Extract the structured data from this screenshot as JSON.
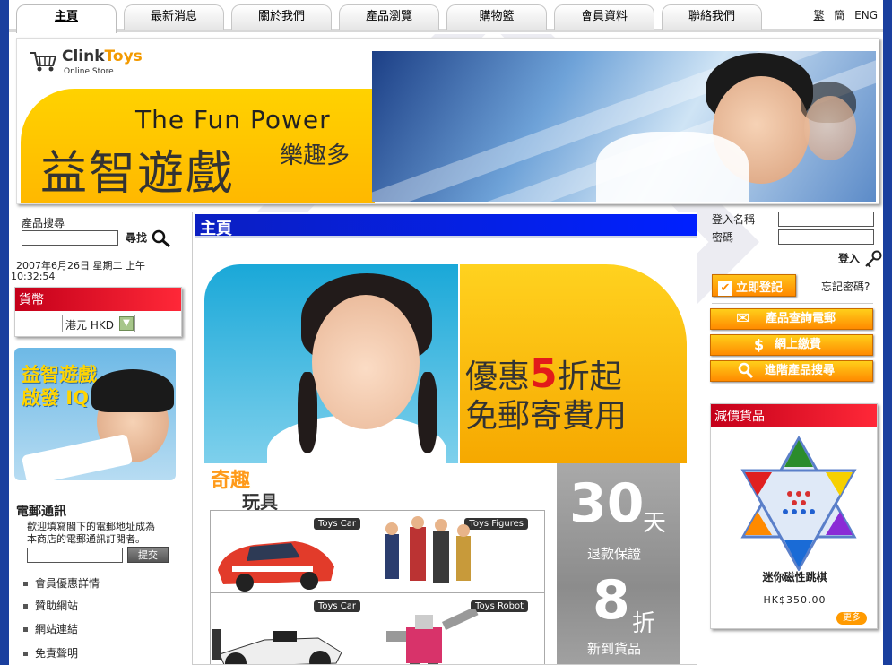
{
  "nav": {
    "tabs": [
      {
        "label": "主頁",
        "active": true
      },
      {
        "label": "最新消息"
      },
      {
        "label": "關於我們"
      },
      {
        "label": "產品瀏覽"
      },
      {
        "label": "購物籃"
      },
      {
        "label": "會員資料"
      },
      {
        "label": "聯絡我們"
      }
    ],
    "languages": [
      "繁",
      "簡",
      "ENG"
    ]
  },
  "banner": {
    "logo_clink": "Clink",
    "logo_toys": "Toys",
    "logo_sub": "Online Store",
    "headline_en": "The Fun Power",
    "headline_big": "益智遊戲",
    "headline_small": "樂趣多"
  },
  "left": {
    "search_label": "產品搜尋",
    "search_button": "尋找",
    "datetime_line1": "2007年6月26日 星期二 上午",
    "datetime_line2": "10:32:54",
    "currency_title": "貨幣",
    "currency_selected": "港元 HKD",
    "promo_line1": "益智遊戲",
    "promo_line2": "啟發 IQ",
    "newsletter_title": "電郵通訊",
    "newsletter_desc1": "歡迎填寫閣下的電郵地址成為",
    "newsletter_desc2": "本商店的電郵通訊訂閱者。",
    "newsletter_submit": "提交",
    "links": [
      "會員優惠詳情",
      "贊助網站",
      "網站連結",
      "免責聲明"
    ]
  },
  "main": {
    "title": "主頁",
    "hero_line1_a": "優惠",
    "hero_line1_num": "5",
    "hero_line1_b": "折起",
    "hero_line2": "免郵寄費用",
    "section_title1": "奇趣",
    "section_title2": "玩具",
    "products": [
      {
        "tag": "Toys Car"
      },
      {
        "tag": "Toys Figures"
      },
      {
        "tag": "Toys Car"
      },
      {
        "tag": "Toys Robot"
      }
    ],
    "offer1_num": "30",
    "offer1_unit": "天",
    "offer1_desc": "退款保證",
    "offer2_num": "8",
    "offer2_unit": "折",
    "offer2_desc": "新到貨品"
  },
  "right": {
    "login_name_label": "登入名稱",
    "password_label": "密碼",
    "login_button": "登入",
    "register_button": "立即登記",
    "forgot_password": "忘記密碼?",
    "btn_enquiry": "產品查詢電郵",
    "btn_payment": "網上繳費",
    "btn_advsearch": "進階產品搜尋",
    "sale_title": "減價貨品",
    "sale_product_name": "迷你磁性跳棋",
    "sale_product_price": "HK$350.00",
    "more_button": "更多"
  },
  "colors": {
    "nav_blue": "#1a3f9e",
    "main_header_blue": "#0020ff",
    "red_header": "#e0001c",
    "orange_button": "#ff9a00"
  }
}
